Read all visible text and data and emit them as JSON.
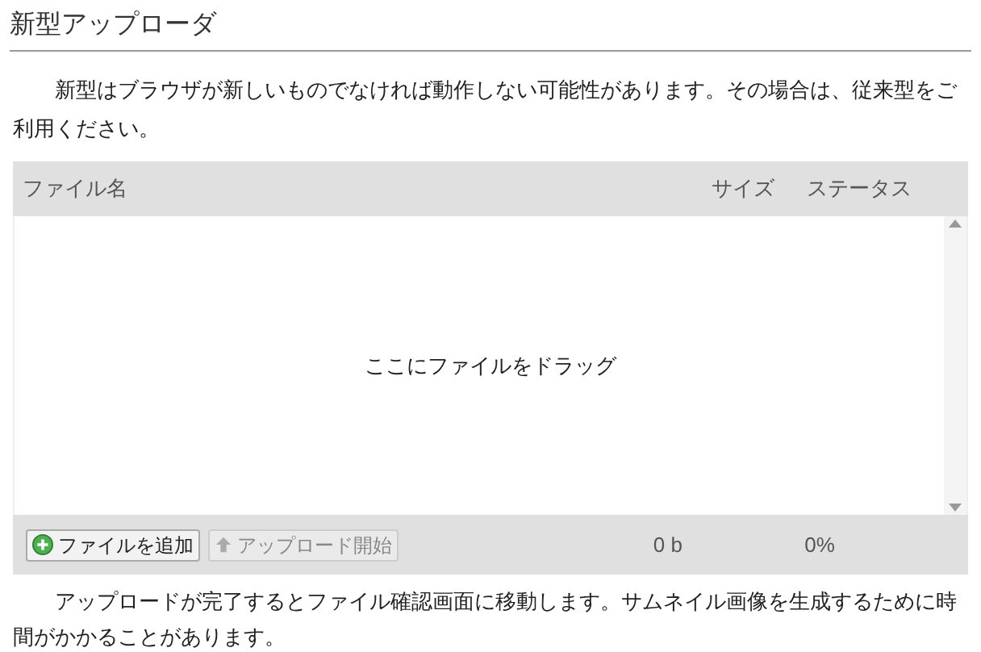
{
  "title": "新型アップローダ",
  "intro": "新型はブラウザが新しいものでなければ動作しない可能性があります。その場合は、従来型をご利用ください。",
  "table": {
    "columns": [
      "ファイル名",
      "サイズ",
      "ステータス"
    ],
    "drop_hint": "ここにファイルをドラッグ"
  },
  "buttons": [
    {
      "label": "ファイルを追加",
      "kind": "add",
      "disabled": false
    },
    {
      "label": "アップロード開始",
      "kind": "upload",
      "disabled": true
    }
  ],
  "total_size": "0 b",
  "total_percent": "0%",
  "note": "アップロードが完了するとファイル確認画面に移動します。サムネイル画像を生成するために時間がかかることがあります。"
}
